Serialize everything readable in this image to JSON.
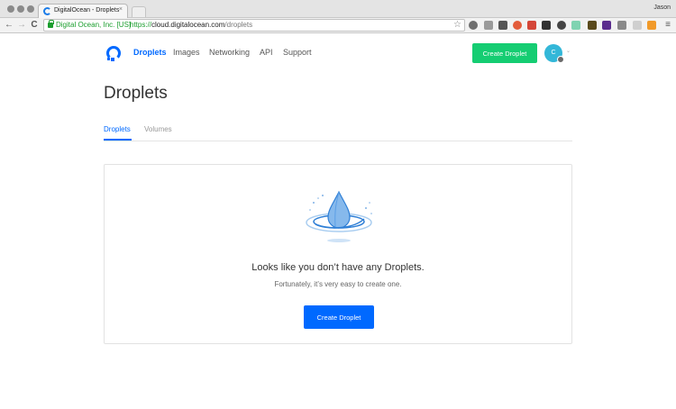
{
  "browser": {
    "tab_title": "DigitalOcean - Droplets",
    "tab_close": "×",
    "profile_name": "Jason",
    "ev_label": "Digital Ocean, Inc. [US]",
    "url_scheme": "https://",
    "url_host": "cloud.digitalocean.com",
    "url_path": "/droplets",
    "back_icon": "←",
    "forward_icon": "→",
    "reload_icon": "C",
    "star_icon": "☆",
    "menu_icon": "≡"
  },
  "header": {
    "nav": [
      "Droplets",
      "Images",
      "Networking",
      "API",
      "Support"
    ],
    "active_nav": "Droplets",
    "create_button": "Create Droplet",
    "avatar_initial": "C"
  },
  "page": {
    "title": "Droplets",
    "tabs": [
      "Droplets",
      "Volumes"
    ],
    "active_tab": "Droplets"
  },
  "empty_state": {
    "heading": "Looks like you don’t have any Droplets.",
    "subtext": "Fortunately, it’s very easy to create one.",
    "button": "Create Droplet"
  },
  "colors": {
    "brand_blue": "#0069ff",
    "create_green": "#15cd72",
    "avatar": "#33b7d8"
  }
}
